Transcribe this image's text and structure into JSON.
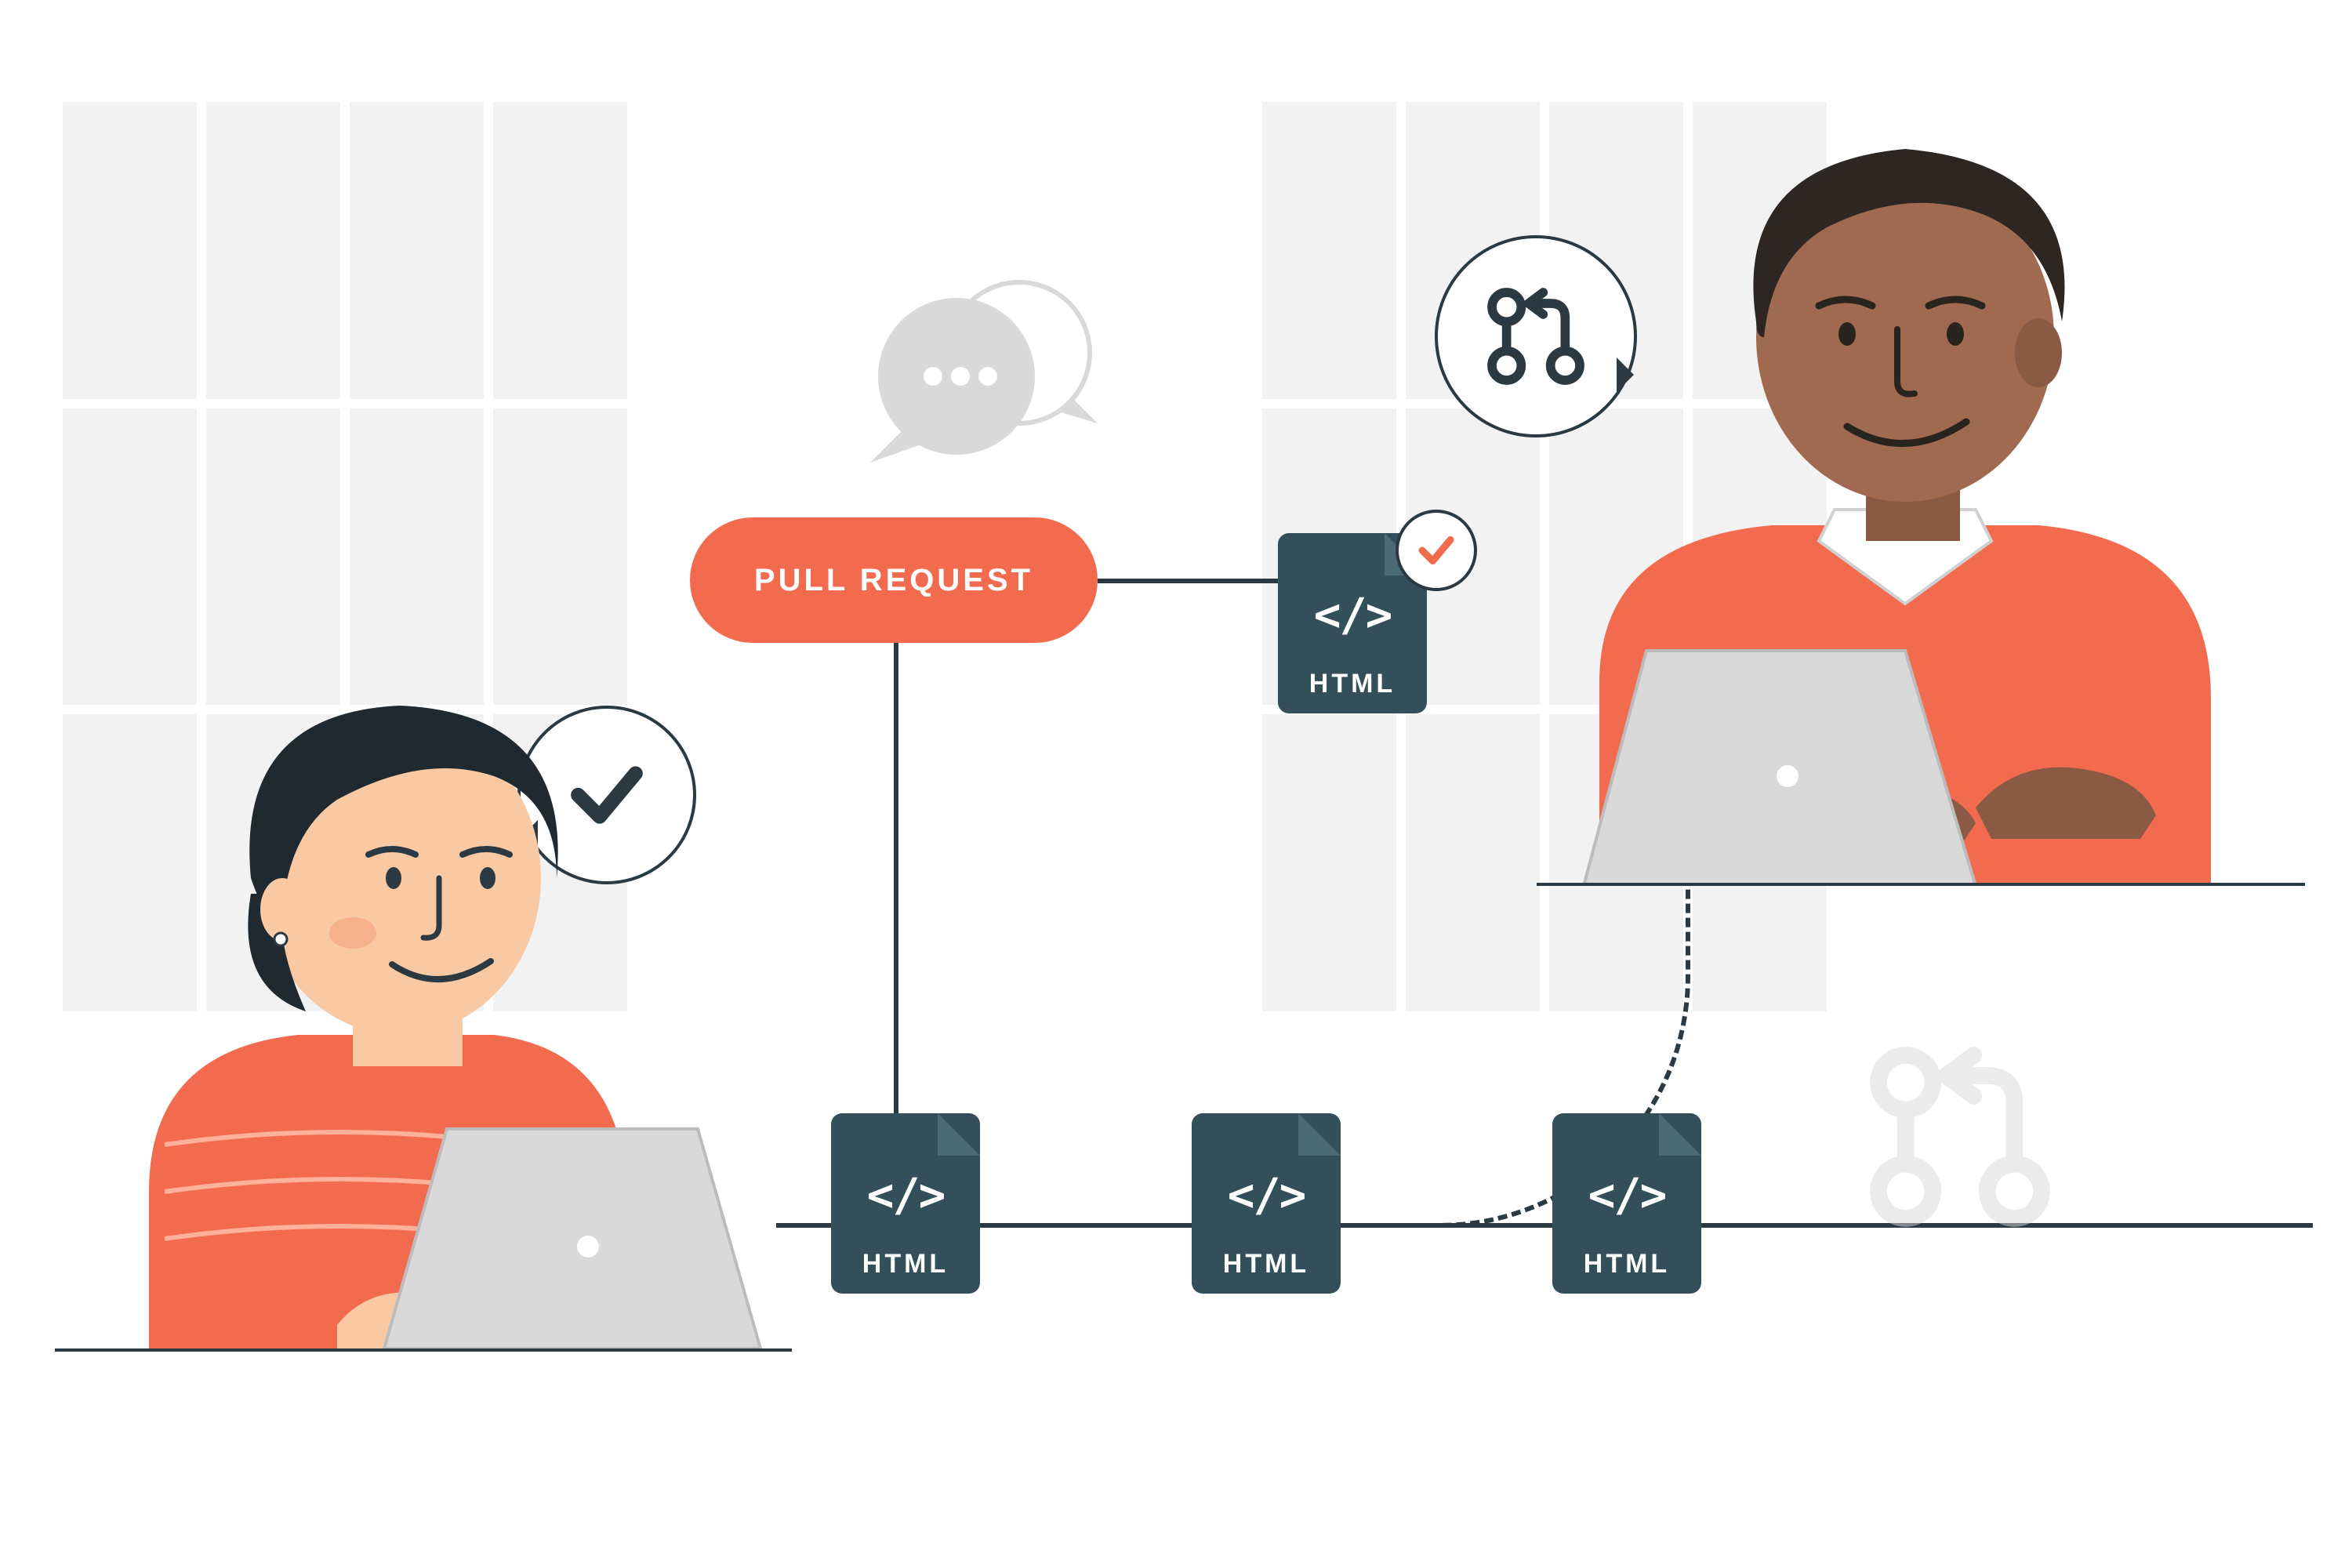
{
  "pill_label": "PULL REQUEST",
  "files": {
    "top": {
      "label": "HTML",
      "code": "</>"
    },
    "b1": {
      "label": "HTML",
      "code": "</>"
    },
    "b2": {
      "label": "HTML",
      "code": "</>"
    },
    "b3": {
      "label": "HTML",
      "code": "</>"
    }
  },
  "icons": {
    "checkmark": "checkmark",
    "pull_request": "git-pull-request",
    "chat": "chat-ellipsis"
  },
  "colors": {
    "accent": "#f26b4e",
    "file_bg": "#33505a",
    "line": "#2a3942",
    "skin_left": "#f9c9a3",
    "skin_right": "#8a5a44",
    "hair_left": "#1e2a30",
    "hair_right": "#2e2623",
    "laptop": "#d9d9d9"
  }
}
